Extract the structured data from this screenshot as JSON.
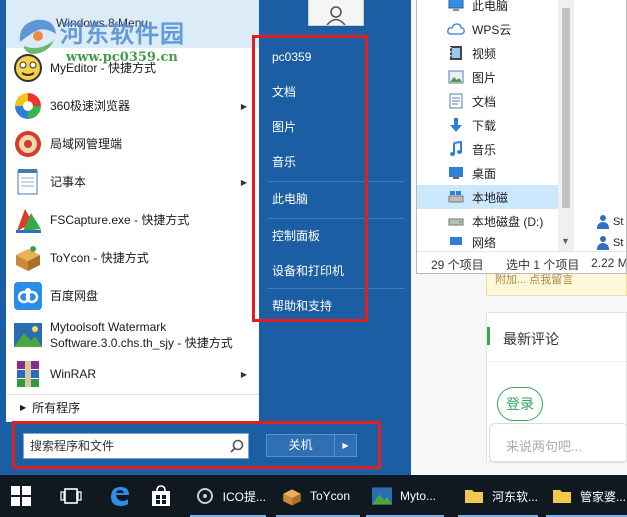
{
  "watermark": {
    "site_name": "河东软件园",
    "url": "www.pc0359.cn"
  },
  "start_menu": {
    "title": "Windows 8 Menu",
    "programs": [
      {
        "label": "MyEditor - 快捷方式",
        "has_submenu": false,
        "icon": "myeditor-icon"
      },
      {
        "label": "360极速浏览器",
        "has_submenu": true,
        "icon": "360-browser-icon"
      },
      {
        "label": "局域网管理端",
        "has_submenu": false,
        "icon": "lan-manager-icon"
      },
      {
        "label": "记事本",
        "has_submenu": true,
        "icon": "notepad-icon"
      },
      {
        "label": "FSCapture.exe - 快捷方式",
        "has_submenu": false,
        "icon": "fscapture-icon"
      },
      {
        "label": "ToYcon - 快捷方式",
        "has_submenu": false,
        "icon": "toycon-icon"
      },
      {
        "label": "百度网盘",
        "has_submenu": false,
        "icon": "baidu-netdisk-icon"
      },
      {
        "label_line1": "Mytoolsoft Watermark",
        "label_line2": "Software.3.0.chs.th_sjy - 快捷方式",
        "has_submenu": false,
        "icon": "watermark-software-icon"
      },
      {
        "label": "WinRAR",
        "has_submenu": true,
        "icon": "winrar-icon"
      }
    ],
    "all_programs": "所有程序",
    "search_placeholder": "搜索程序和文件",
    "places": [
      "pc0359",
      "文档",
      "图片",
      "音乐",
      "此电脑",
      "控制面板",
      "设备和打印机",
      "帮助和支持"
    ],
    "shutdown_label": "关机"
  },
  "explorer": {
    "nav_items": [
      {
        "label": "此电脑",
        "icon": "pc-icon"
      },
      {
        "label": "WPS云",
        "icon": "wps-cloud-icon"
      },
      {
        "label": "视频",
        "icon": "video-icon"
      },
      {
        "label": "图片",
        "icon": "pictures-icon"
      },
      {
        "label": "文档",
        "icon": "documents-icon"
      },
      {
        "label": "下载",
        "icon": "download-icon"
      },
      {
        "label": "音乐",
        "icon": "music-icon"
      },
      {
        "label": "桌面",
        "icon": "desktop-icon"
      },
      {
        "label": "本地磁",
        "icon": "local-disk-icon",
        "selected": true
      },
      {
        "label": "本地磁盘 (D:)",
        "icon": "local-disk-icon"
      },
      {
        "label": "网络",
        "icon": "network-icon"
      }
    ],
    "files": [
      "St",
      "St"
    ],
    "status": {
      "count": "29 个项目",
      "selected": "选中 1 个项目",
      "size": "2.22 M"
    }
  },
  "webpage": {
    "notice": "附加... 点我留言",
    "comments_title": "最新评论",
    "login_label": "登录",
    "comment_placeholder": "来说两句吧..."
  },
  "taskbar": {
    "items": [
      {
        "label": "ICO提...",
        "icon": "ico-tool-icon"
      },
      {
        "label": "ToYcon",
        "icon": "toycon-icon"
      },
      {
        "label": "Myto...",
        "icon": "mytoolsoft-icon"
      },
      {
        "label": "河东软...",
        "icon": "folder-icon"
      },
      {
        "label": "管家婆...",
        "icon": "folder-icon"
      }
    ]
  },
  "colors": {
    "start_blue": "#1c5ea4",
    "highlight_red": "#e02020",
    "taskbar": "#101820"
  }
}
